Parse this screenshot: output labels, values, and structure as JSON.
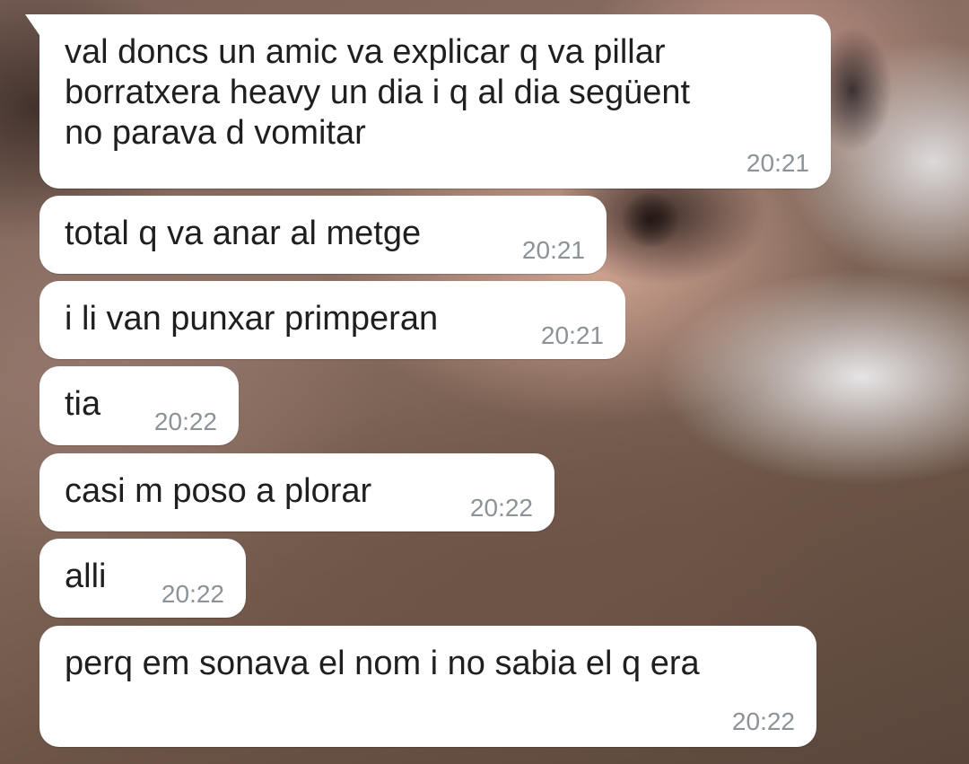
{
  "messages": [
    {
      "text": "val doncs un amic va explicar q va pillar\nborratxera heavy un dia i q al dia següent\nno parava d vomitar",
      "time": "20:21"
    },
    {
      "text": "total q va anar al metge",
      "time": "20:21"
    },
    {
      "text": "i li van punxar primperan",
      "time": "20:21"
    },
    {
      "text": "tia",
      "time": "20:22"
    },
    {
      "text": "casi m poso a plorar",
      "time": "20:22"
    },
    {
      "text": "alli",
      "time": "20:22"
    },
    {
      "text": "perq em sonava el nom i no sabia el q era",
      "time": "20:22"
    }
  ],
  "colors": {
    "bubble_bg": "#ffffff",
    "text": "#1f1f1f",
    "timestamp": "#8b9399"
  }
}
